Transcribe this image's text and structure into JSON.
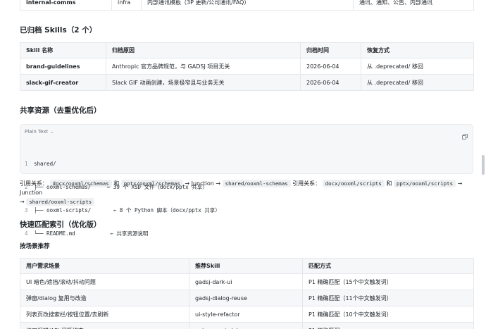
{
  "top_table": {
    "row": [
      "internal-comms",
      "infra",
      "内部通讯模板（3P 更新/公司通讯/FAQ）",
      "通讯、通知、公告、内部通讯"
    ]
  },
  "archived": {
    "heading": "已归档 Skills（2 个）",
    "columns": [
      "Skill 名称",
      "归档原因",
      "归档时间",
      "恢复方式"
    ],
    "rows": [
      [
        "brand-guidelines",
        "Anthropic 官方品牌规范，与 GADSJ 项目无关",
        "2026-06-04",
        "从 .deprecated/ 移回"
      ],
      [
        "slack-gif-creator",
        "Slack GIF 动画创建，场景极窄且与业务无关",
        "2026-06-04",
        "从 .deprecated/ 移回"
      ]
    ]
  },
  "shared": {
    "heading": "共享资源（去重优化后）",
    "code_lang": "Plain Text",
    "code_lines": [
      {
        "n": "1",
        "text": "shared/"
      },
      {
        "n": "2",
        "text": "├── ooxml-schemas/     ← 39 个 XSD 文件（docx/pptx 共享）"
      },
      {
        "n": "3",
        "text": "├── ooxml-scripts/       ← 8 个 Python 脚本（docx/pptx 共享）"
      },
      {
        "n": "4",
        "text": "└── README.md           ← 共享资源说明"
      }
    ],
    "relation": {
      "label1": "引用关系：",
      "code1": "docx/ooxml/schemas",
      "and1": "和",
      "code2": "pptx/ooxml/schemas",
      "arrow1": "→ Junction →",
      "code3": "shared/ooxml-schemas",
      "label2": "引用关系：",
      "code4": "docx/ooxml/scripts",
      "and2": "和",
      "code5": "pptx/ooxml/scripts",
      "arrow2": "→ Junction",
      "arrow3": "→",
      "code6": "shared/ooxml-scripts"
    }
  },
  "quick": {
    "heading": "快速匹配索引（优化版）",
    "subheading": "按场景推荐",
    "columns": [
      "用户需求场景",
      "推荐Skill",
      "匹配方式"
    ],
    "rows": [
      [
        "UI 暗色/遮挡/滚动/抖动问题",
        "gadsj-dark-ui",
        "P1 精确匹配（15个中文触发词）"
      ],
      [
        "弹窗/dialog 复用与改造",
        "gadsj-dialog-reuse",
        "P1 精确匹配（11个中文触发词）"
      ],
      [
        "列表页改搜索栏/按钮位置/去刷新",
        "ui-style-refactor",
        "P1 精确匹配（10个中文触发词）"
      ],
      [
        "接口报错/API 问题排查",
        "api-request-debugger",
        "P1 精确匹配"
      ]
    ]
  }
}
